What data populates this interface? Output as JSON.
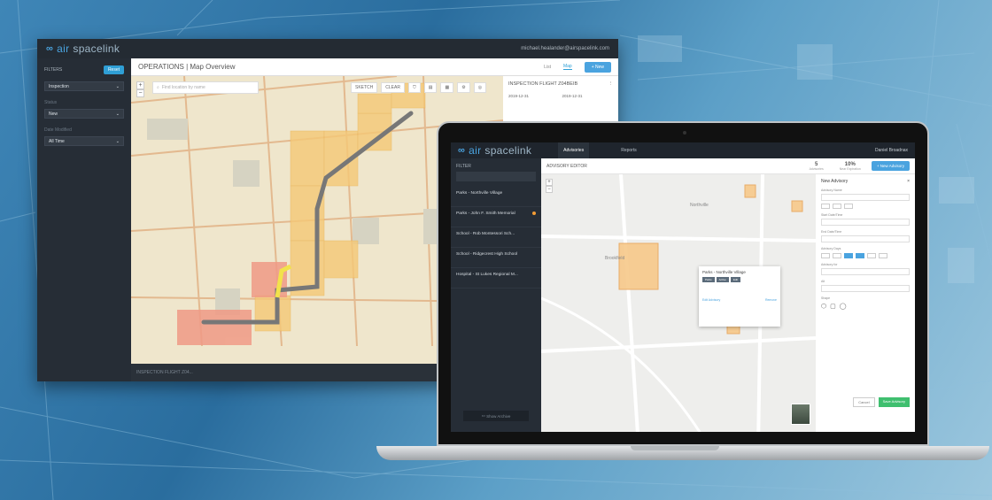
{
  "monitor": {
    "brand_air": "air",
    "brand_rest": "spacelink",
    "user_email": "michael.healander@airspacelink.com",
    "filters_label": "FILTERS",
    "reset_label": "Reset",
    "filter1_value": "Inspection",
    "filter2_label": "Status",
    "filter2_value": "New",
    "filter3_label": "Date Modified",
    "filter3_value": "All Time",
    "title": "OPERATIONS | Map Overview",
    "tab_list": "List",
    "tab_map": "Map",
    "new_button": "+ New",
    "search_placeholder": "Find location by name",
    "tool_sketch": "SKETCH",
    "tool_clear": "CLEAR",
    "panel_title": "INSPECTION FLIGHT Z04BEIB",
    "panel_date1": "2019-12-31",
    "panel_date2": "2019-12-31",
    "footer_text": "INSPECTION FLIGHT Z04..."
  },
  "laptop": {
    "brand_air": "air",
    "brand_rest": "spacelink",
    "tab_advisories": "Advisories",
    "tab_reports": "Reports",
    "user": "Daniel Broadnax",
    "filter_label": "FILTER",
    "map_title": "ADVISORY EDITOR",
    "stat1_value": "5",
    "stat1_label": "Advisories",
    "stat2_value": "10%",
    "stat2_label": "Near Expiration",
    "create_button": "+ New Advisory",
    "items": [
      {
        "title": "Parks - Northville Village"
      },
      {
        "title": "Parks - John F. Smith Memorial"
      },
      {
        "title": "School - Rob Montessori Sch..."
      },
      {
        "title": "School - Ridgecrest High School"
      },
      {
        "title": "Hospital - St Lukes Regional M..."
      }
    ],
    "show_archive": "Show Archive",
    "popup_title": "Parks - Northville Village",
    "popup_chip1": "Parks",
    "popup_chip2": "Active",
    "popup_chip3": "Edit",
    "popup_link1": "Edit Advisory",
    "popup_link2": "Remove",
    "form_title": "New Advisory",
    "form_label1": "Advisory Name",
    "form_label2": "Start Date/Time",
    "form_label3": "End Date/Time",
    "form_label4": "Advisory Days",
    "form_label5": "Advisory for",
    "form_label6": "Alt",
    "form_label7": "Shape",
    "cancel": "Cancel",
    "save": "Save Advisory",
    "map_label1": "Northville",
    "map_label2": "Brookfield"
  }
}
